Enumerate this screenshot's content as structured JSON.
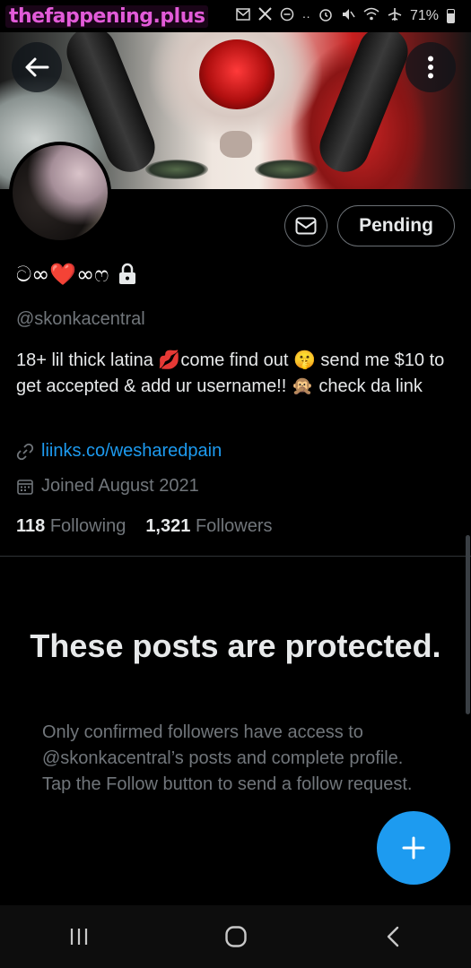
{
  "status_bar": {
    "watermark": "thefappening.plus",
    "battery": "71%",
    "icons": [
      "mail-icon",
      "x-icon",
      "dnd-icon",
      "more-dots-icon",
      "alarm-icon",
      "mute-icon",
      "wifi-icon",
      "airplane-icon",
      "battery-icon"
    ]
  },
  "header": {
    "back_icon": "arrow-left-icon",
    "more_icon": "more-vertical-icon"
  },
  "profile": {
    "display_name": "ට∞❤️∞ෆ",
    "protected_icon": "lock-icon",
    "handle": "@skonkacentral",
    "bio": "18+ lil thick latina 💋come find out 🤫 send me $10 to get accepted & add ur username!! 🙊 check da link",
    "link_icon": "link-icon",
    "link": "liinks.co/wesharedpain",
    "joined_icon": "calendar-icon",
    "joined": "Joined August 2021",
    "following_count": "118",
    "following_label": "Following",
    "followers_count": "1,321",
    "followers_label": "Followers"
  },
  "actions": {
    "message_icon": "envelope-icon",
    "pending_label": "Pending"
  },
  "protected": {
    "title": "These posts are protected.",
    "body": "Only confirmed followers have access to @skonkacentral’s posts and complete profile. Tap the Follow button to send a follow request."
  },
  "fab": {
    "icon": "plus-icon"
  },
  "nav_bar": {
    "icons": [
      "recents-icon",
      "home-icon",
      "back-icon"
    ]
  },
  "colors": {
    "accent": "#1d9bf0",
    "muted": "#71767b",
    "text": "#e7e9ea",
    "watermark": "#e25bd8"
  }
}
